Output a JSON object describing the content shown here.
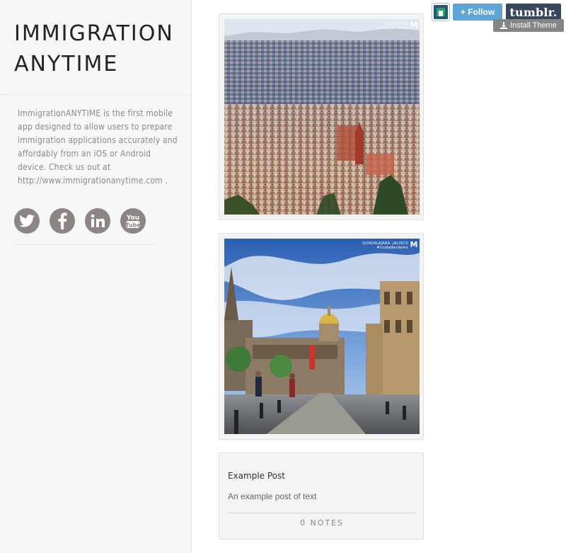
{
  "sidebar": {
    "title_line1": "IMMIGRATION",
    "title_line2": "ANYTIME",
    "description": "ImmigrationANYTIME is the first mobile app designed to allow users to prepare immigration applications accurately and affordably from an iOS or Android device. Check us out at http://www.immigrationanytime.com .",
    "social": [
      {
        "name": "twitter",
        "icon": "twitter-icon"
      },
      {
        "name": "facebook",
        "icon": "facebook-icon"
      },
      {
        "name": "linkedin",
        "icon": "linkedin-icon"
      },
      {
        "name": "youtube",
        "icon": "youtube-icon"
      }
    ],
    "social_icon_color": "#8d8583"
  },
  "posts": [
    {
      "type": "photo",
      "watermark": "ZACATECAS\n#ciudadesdemx",
      "watermark_logo": "M"
    },
    {
      "type": "photo",
      "watermark": "GUADALAJARA, JALISCO\n#ciudadesdemx",
      "watermark_logo": "M"
    },
    {
      "type": "text",
      "title": "Example Post",
      "body": "An example post of text",
      "notes": "0 NOTES"
    }
  ],
  "tumblr_controls": {
    "follow_label": "+ Follow",
    "tumblr_label": "tumblr.",
    "install_label": "Install Theme",
    "follow_color": "#5ea4d4",
    "tumblr_color": "#36465d",
    "install_color": "#858585"
  }
}
